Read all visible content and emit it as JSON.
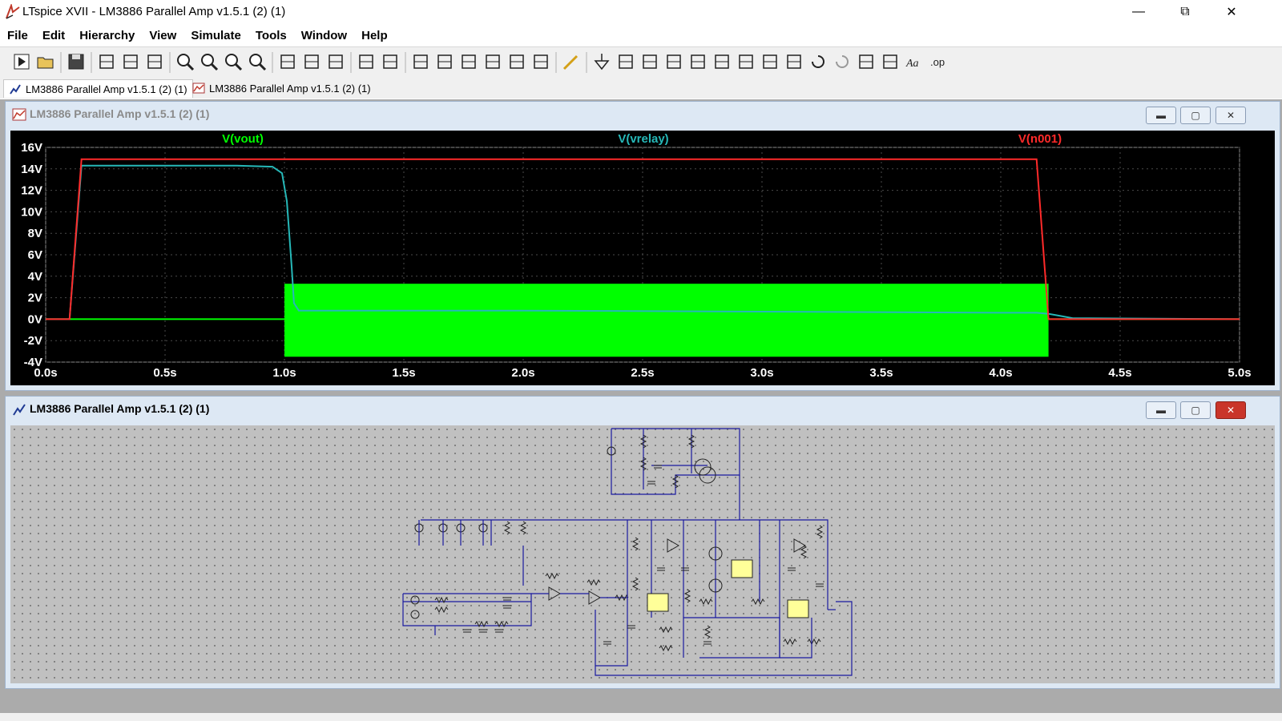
{
  "window": {
    "title": "LTspice XVII - LM3886 Parallel Amp v1.5.1 (2) (1)"
  },
  "menu": [
    "File",
    "Edit",
    "Hierarchy",
    "View",
    "Simulate",
    "Tools",
    "Window",
    "Help"
  ],
  "toolbar": {
    "icons": [
      "run-icon",
      "open-icon",
      "save-icon",
      "control-panel-icon",
      "halt-icon",
      "pan-icon",
      "zoom-in-icon",
      "zoom-area-icon",
      "zoom-out-icon",
      "zoom-fit-icon",
      "autorange-icon",
      "grid-icon",
      "tile-horizontal-icon",
      "cascade-icon",
      "tile-vertical-icon",
      "cut-icon",
      "copy-icon",
      "paste-icon",
      "find-icon",
      "print-preview-icon",
      "print-icon",
      "wire-icon",
      "ground-icon",
      "label-net-icon",
      "resistor-icon",
      "capacitor-icon",
      "inductor-icon",
      "diode-icon",
      "component-icon",
      "move-icon",
      "drag-icon",
      "undo-icon",
      "redo-icon",
      "rotate-icon",
      "mirror-icon",
      "text-icon",
      "spice-directive-icon"
    ],
    "spice_label": ".op",
    "text_label": "Aa"
  },
  "tabs": [
    {
      "label": "LM3886 Parallel Amp v1.5.1 (2) (1)",
      "kind": "schematic"
    },
    {
      "label": "LM3886 Parallel Amp v1.5.1 (2) (1)",
      "kind": "waveform"
    }
  ],
  "plot_window": {
    "title": "LM3886 Parallel Amp v1.5.1 (2) (1)"
  },
  "schematic_window": {
    "title": "LM3886 Parallel Amp v1.5.1 (2) (1)"
  },
  "colors": {
    "vout": "#00ff00",
    "vrelay": "#26b8b8",
    "n001": "#ff2a2a",
    "plot_bg": "#000000",
    "grid": "#4a4a4a",
    "wire": "#1a1aa0"
  },
  "chart_data": {
    "type": "line",
    "title": "",
    "xlabel": "",
    "ylabel": "",
    "xlim": [
      0,
      5
    ],
    "ylim": [
      -4,
      16
    ],
    "x_ticks": [
      "0.0s",
      "0.5s",
      "1.0s",
      "1.5s",
      "2.0s",
      "2.5s",
      "3.0s",
      "3.5s",
      "4.0s",
      "4.5s",
      "5.0s"
    ],
    "y_ticks": [
      "16V",
      "14V",
      "12V",
      "10V",
      "8V",
      "6V",
      "4V",
      "2V",
      "0V",
      "-2V",
      "-4V"
    ],
    "x_tick_values": [
      0,
      0.5,
      1.0,
      1.5,
      2.0,
      2.5,
      3.0,
      3.5,
      4.0,
      4.5,
      5.0
    ],
    "y_tick_values": [
      16,
      14,
      12,
      10,
      8,
      6,
      4,
      2,
      0,
      -2,
      -4
    ],
    "grid": true,
    "series": [
      {
        "name": "V(vout)",
        "color": "#00ff00",
        "x": [
          0,
          1.0,
          1.0,
          4.2,
          4.2,
          5.0
        ],
        "y": [
          0,
          0,
          0,
          0,
          0,
          0
        ],
        "envelope": {
          "x_start": 1.0,
          "x_end": 4.2,
          "y_min": -3.5,
          "y_max": 3.3
        }
      },
      {
        "name": "V(vrelay)",
        "color": "#26b8b8",
        "x": [
          0,
          0.1,
          0.15,
          0.5,
          0.8,
          0.95,
          0.99,
          1.01,
          1.03,
          1.04,
          1.06,
          2.0,
          3.0,
          4.0,
          4.15,
          4.2,
          4.25,
          4.3,
          5.0
        ],
        "y": [
          0,
          0,
          14.3,
          14.3,
          14.3,
          14.2,
          13.6,
          11.0,
          5.0,
          1.5,
          0.8,
          0.8,
          0.7,
          0.6,
          0.6,
          0.5,
          0.3,
          0.1,
          0
        ]
      },
      {
        "name": "V(n001)",
        "color": "#ff2a2a",
        "x": [
          0,
          0.1,
          0.15,
          4.15,
          4.2,
          5.0
        ],
        "y": [
          0,
          0,
          14.9,
          14.9,
          0,
          0
        ]
      }
    ]
  }
}
